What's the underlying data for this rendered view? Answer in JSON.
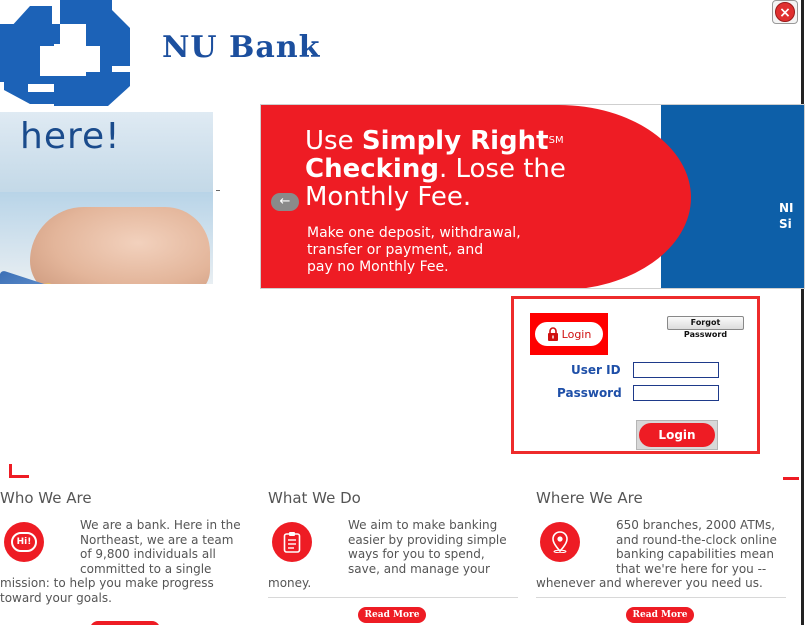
{
  "brand": {
    "name": "NU Bank"
  },
  "close_button": {
    "label": "×"
  },
  "left_banner": {
    "text": "here!"
  },
  "promo": {
    "line1_prefix": "Use ",
    "line1_bold": "Simply Right",
    "line1_mark": "SM",
    "line2_bold": "Checking",
    "line2_rest": ". Lose the",
    "line3": "Monthly Fee.",
    "sub1": "Make one deposit, withdrawal,",
    "sub2": "transfer or payment, and",
    "sub3": "pay no Monthly Fee.",
    "prev_arrow": "←",
    "peek_line1": "NI",
    "peek_line2": "Si",
    "colors": {
      "red": "#ee1c24",
      "blue": "#0d5fa8"
    }
  },
  "login": {
    "header_label": "Login",
    "forgot_label": "Forgot Password",
    "user_label": "User ID",
    "password_label": "Password",
    "user_value": "",
    "password_value": "",
    "submit_label": "Login"
  },
  "sections": [
    {
      "title": "Who We Are",
      "icon": "hi-speech-icon",
      "icon_text": "Hi!",
      "lines": [
        "We are a bank. Here in the",
        "Northeast, we are a team",
        "of 9,800 individuals all",
        "committed to a single",
        "mission: to help you make progress",
        "toward your goals."
      ]
    },
    {
      "title": "What We Do",
      "icon": "clipboard-icon",
      "lines": [
        "We aim to make banking",
        "easier by providing simple",
        "ways for you to spend,",
        "save, and manage your",
        "money."
      ],
      "button": "Read More"
    },
    {
      "title": "Where We Are",
      "icon": "map-pin-icon",
      "lines": [
        "650 branches, 2000 ATMs,",
        "and round-the-clock online",
        "banking capabilities mean",
        "that we're here for you --",
        "whenever and wherever you need us."
      ],
      "button": "Read More"
    }
  ]
}
